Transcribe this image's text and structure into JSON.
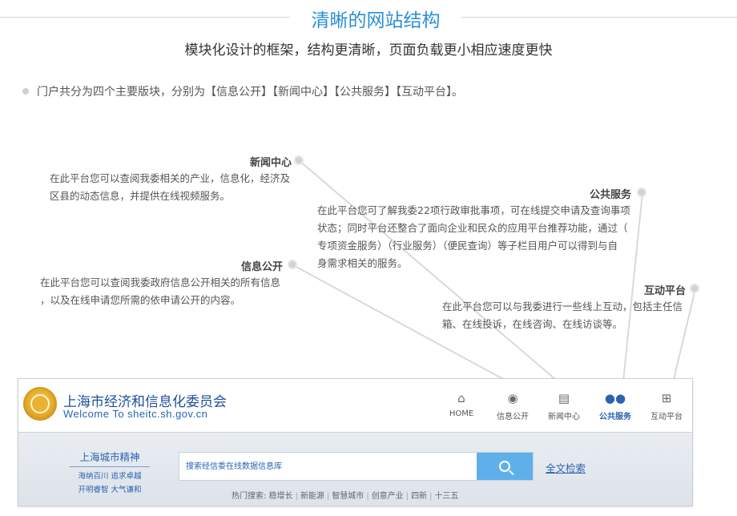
{
  "header": {
    "title": "清晰的网站结构",
    "subtitle": "模块化设计的框架，结构更清晰，页面负载更小相应速度更快"
  },
  "intro": "门户共分为四个主要版块，分别为【信息公开】【新闻中心】【公共服务】【互动平台】。",
  "callouts": {
    "news": {
      "label": "新闻中心",
      "text": [
        "在此平台您可以查阅我委相关的产业，信息化，经济及",
        "区县的动态信息，并提供在线视频服务。"
      ]
    },
    "public_service": {
      "label": "公共服务",
      "text": [
        "在此平台您可了解我委22项行政审批事项，可在线提交申请及查询事项",
        "状态；同时平台还整合了面向企业和民众的应用平台推荐功能，通过（",
        "专项资金服务）（行业服务）（便民查询）等子栏目用户可以得到与自",
        "身需求相关的服务。"
      ]
    },
    "info_open": {
      "label": "信息公开",
      "text": [
        "在此平台您可以查阅我委政府信息公开相关的所有信息",
        "，以及在线申请您所需的依申请公开的内容。"
      ]
    },
    "interaction": {
      "label": "互动平台",
      "text": [
        "在此平台您可以与我委进行一些线上互动，包括主任信",
        "箱、在线投诉，在线咨询、在线访谈等。"
      ]
    }
  },
  "site": {
    "name": "上海市经济和信息化委员会",
    "subtitle": "Welcome To sheitc.sh.gov.cn",
    "nav": [
      {
        "label": "HOME",
        "icon": "home-icon"
      },
      {
        "label": "信息公开",
        "icon": "chat-bubble-icon"
      },
      {
        "label": "新闻中心",
        "icon": "book-icon"
      },
      {
        "label": "公共服务",
        "icon": "users-icon"
      },
      {
        "label": "互动平台",
        "icon": "grid-icon"
      }
    ],
    "spirit": {
      "title": "上海城市精神",
      "line1": "海纳百川 追求卓越",
      "line2": "开明睿智 大气谦和"
    },
    "search": {
      "placeholder": "搜索经信委在线数据信息库"
    },
    "fulltext_label": "全文检索",
    "hot": {
      "label": "热门搜索:",
      "terms": [
        "稳增长",
        "新能源",
        "智慧城市",
        "创意产业",
        "四新",
        "十三五"
      ]
    }
  },
  "colors": {
    "accent": "#2a8fd4",
    "brand_blue": "#2b63b0",
    "search_button": "#5fb0ea"
  }
}
